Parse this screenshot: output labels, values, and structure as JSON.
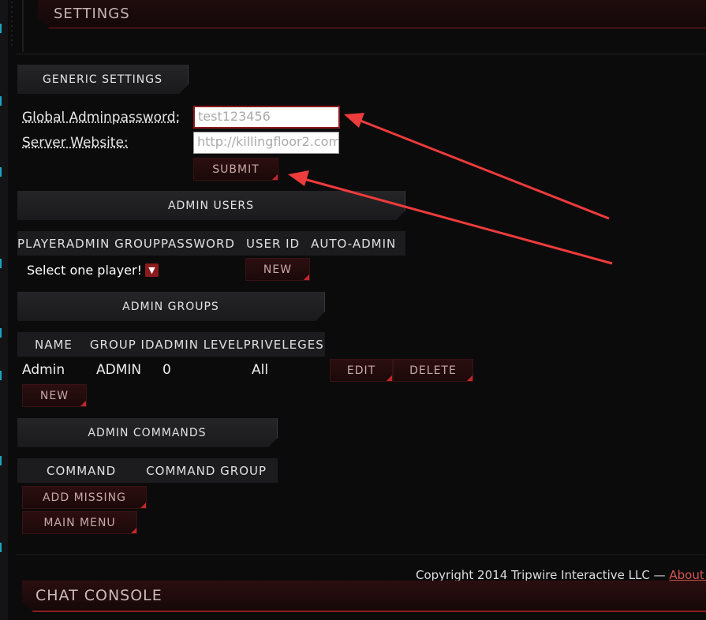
{
  "header": {
    "title": "SETTINGS"
  },
  "generic": {
    "title": "GENERIC SETTINGS",
    "admin_password_label": "Global Adminpassword:",
    "admin_password_value": "test123456",
    "website_label": "Server Website:",
    "website_value": "http://killingfloor2.com",
    "submit_label": "SUBMIT"
  },
  "admin_users": {
    "title": "ADMIN USERS",
    "columns": [
      "PLAYER",
      "ADMIN GROUP",
      "PASSWORD",
      "USER ID",
      "AUTO-ADMIN"
    ],
    "select_value": "Select one player!",
    "new_label": "NEW"
  },
  "admin_groups": {
    "title": "ADMIN GROUPS",
    "columns": [
      "NAME",
      "GROUP ID",
      "ADMIN LEVEL",
      "PRIVELEGES"
    ],
    "rows": [
      {
        "name": "Admin",
        "group_id": "ADMIN",
        "admin_level": "0",
        "privileges": "All"
      }
    ],
    "edit_label": "EDIT",
    "delete_label": "DELETE",
    "new_label": "NEW"
  },
  "admin_commands": {
    "title": "ADMIN COMMANDS",
    "columns": [
      "COMMAND",
      "COMMAND GROUP"
    ],
    "add_missing_label": "ADD MISSING",
    "main_menu_label": "MAIN MENU"
  },
  "footer": {
    "copyright": "Copyright 2014 Tripwire Interactive LLC — ",
    "about_link": "About this"
  },
  "chat_console": {
    "title": "CHAT CONSOLE"
  },
  "colors": {
    "accent_red": "#8b1a1d",
    "annotation_arrow": "#ee3b3b",
    "rail_cyan": "#1aa6c4"
  }
}
